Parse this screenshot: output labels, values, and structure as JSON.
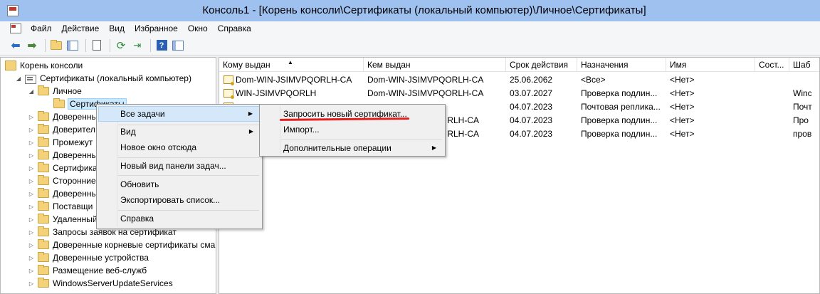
{
  "window": {
    "title": "Консоль1 - [Корень консоли\\Сертификаты (локальный компьютер)\\Личное\\Сертификаты]"
  },
  "menubar": {
    "items": [
      "Файл",
      "Действие",
      "Вид",
      "Избранное",
      "Окно",
      "Справка"
    ]
  },
  "tree": {
    "root": "Корень консоли",
    "store": "Сертификаты (локальный компьютер)",
    "personal": "Личное",
    "selected": "Сертификаты",
    "items": [
      "Доверенны",
      "Доверител",
      "Промежут",
      "Доверенны",
      "Сертифика",
      "Сторонние",
      "Доверенны",
      "Поставщи",
      "Удаленный",
      "Запросы заявок на сертификат",
      "Доверенные корневые сертификаты сма",
      "Доверенные устройства",
      "Размещение веб-служб",
      "WindowsServerUpdateServices"
    ]
  },
  "list": {
    "columns": [
      "Кому выдан",
      "Кем выдан",
      "Срок действия",
      "Назначения",
      "Имя",
      "Сост...",
      "Шаб"
    ],
    "rows": [
      [
        "Dom-WIN-JSIMVPQORLH-CA",
        "Dom-WIN-JSIMVPQORLH-CA",
        "25.06.2062",
        "<Все>",
        "<Нет>",
        "",
        ""
      ],
      [
        "WIN-JSIMVPQORLH",
        "Dom-WIN-JSIMVPQORLH-CA",
        "03.07.2027",
        "Проверка подлин...",
        "<Нет>",
        "",
        "Winc"
      ],
      [
        "",
        "",
        "04.07.2023",
        "Почтовая реплика...",
        "<Нет>",
        "",
        "Почт"
      ],
      [
        "",
        "RLH-CA",
        "04.07.2023",
        "Проверка подлин...",
        "<Нет>",
        "",
        "Про"
      ],
      [
        "",
        "RLH-CA",
        "04.07.2023",
        "Проверка подлин...",
        "<Нет>",
        "",
        "пров"
      ]
    ]
  },
  "context_menu": {
    "items": [
      "Все задачи",
      "Вид",
      "Новое окно отсюда",
      "Новый вид панели задач...",
      "Обновить",
      "Экспортировать список...",
      "Справка"
    ]
  },
  "submenu": {
    "items": [
      "Запросить новый сертификат...",
      "Импорт...",
      "Дополнительные операции"
    ]
  }
}
